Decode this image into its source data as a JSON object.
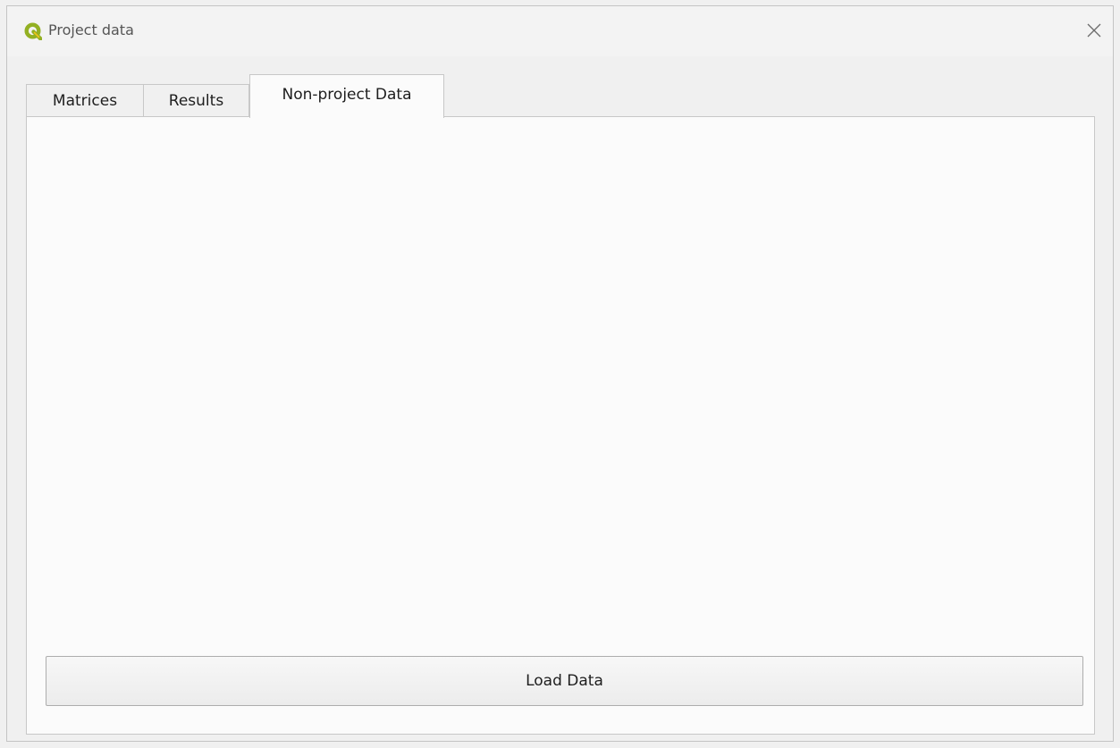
{
  "window": {
    "title": "Project data",
    "app_icon": "qgis-logo-icon",
    "close_icon": "close-icon"
  },
  "tabs": [
    {
      "label": "Matrices",
      "active": false
    },
    {
      "label": "Results",
      "active": false
    },
    {
      "label": "Non-project Data",
      "active": true
    }
  ],
  "panel": {
    "load_button_label": "Load Data"
  },
  "colors": {
    "window_bg": "#f0f0f0",
    "panel_bg": "#fbfbfb",
    "border": "#c8c8c8",
    "qgis_green": "#93b023",
    "qgis_yellow": "#f0c31a"
  }
}
